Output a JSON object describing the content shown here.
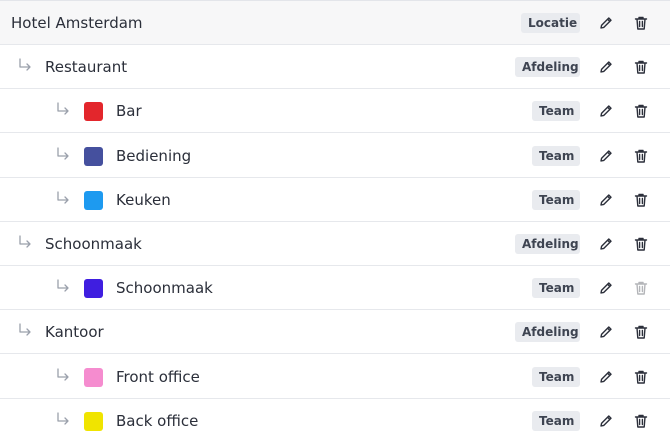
{
  "colors": {
    "bar": "#e3262c",
    "bediening": "#45509e",
    "keuken": "#1d9af0",
    "schoonmaak": "#3f1ee0",
    "front_office": "#f58ccf",
    "back_office": "#f0e400"
  },
  "rows": [
    {
      "label": "Hotel Amsterdam",
      "badge": "Locatie",
      "icon_edit": "pencil-icon",
      "icon_delete": "trash-icon"
    },
    {
      "label": "Restaurant",
      "badge": "Afdeling",
      "icon_edit": "pencil-icon",
      "icon_delete": "trash-icon"
    },
    {
      "label": "Bar",
      "badge": "Team",
      "icon_edit": "pencil-icon",
      "icon_delete": "trash-icon"
    },
    {
      "label": "Bediening",
      "badge": "Team",
      "icon_edit": "pencil-icon",
      "icon_delete": "trash-icon"
    },
    {
      "label": "Keuken",
      "badge": "Team",
      "icon_edit": "pencil-icon",
      "icon_delete": "trash-icon"
    },
    {
      "label": "Schoonmaak",
      "badge": "Afdeling",
      "icon_edit": "pencil-icon",
      "icon_delete": "trash-icon"
    },
    {
      "label": "Schoonmaak",
      "badge": "Team",
      "icon_edit": "pencil-icon",
      "icon_delete": "trash-icon",
      "delete_disabled": true
    },
    {
      "label": "Kantoor",
      "badge": "Afdeling",
      "icon_edit": "pencil-icon",
      "icon_delete": "trash-icon"
    },
    {
      "label": "Front office",
      "badge": "Team",
      "icon_edit": "pencil-icon",
      "icon_delete": "trash-icon"
    },
    {
      "label": "Back office",
      "badge": "Team",
      "icon_edit": "pencil-icon",
      "icon_delete": "trash-icon"
    }
  ]
}
